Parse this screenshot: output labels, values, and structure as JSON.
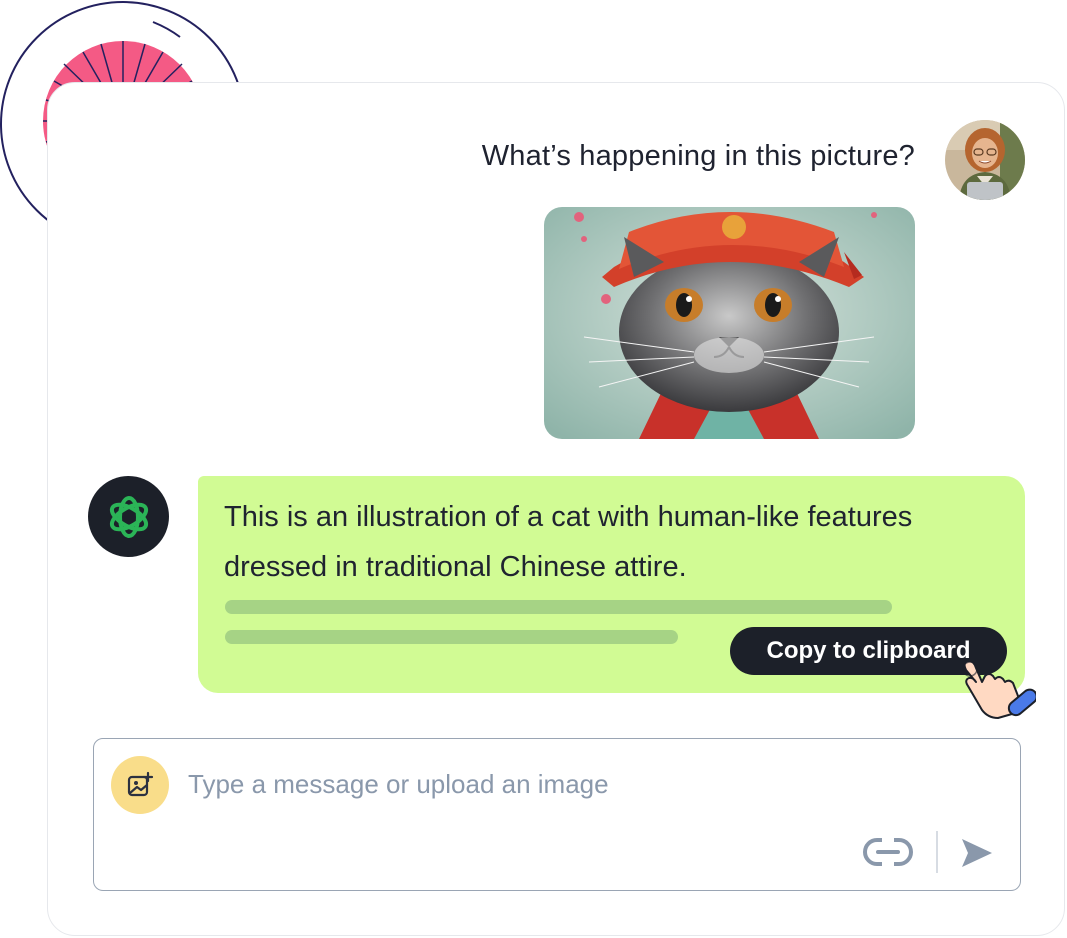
{
  "conversation": {
    "user_message": "What’s happening in this picture?",
    "assistant_message": "This is an illustration of a cat with human-like features dressed in traditional Chinese attire.",
    "copy_button_label": "Copy to clipboard"
  },
  "composer": {
    "placeholder": "Type a message or upload an image",
    "value": ""
  },
  "icons": {
    "eye": "eye-illustration",
    "user_avatar": "user-avatar",
    "assistant_avatar": "openai-logo-icon",
    "upload": "image-upload-icon",
    "link": "link-icon",
    "send": "send-icon",
    "cursor": "pointing-hand-icon"
  },
  "colors": {
    "assistant_bubble": "#d1fb94",
    "skeleton": "#a6d385",
    "dark": "#1c2029",
    "eye_iris": "#f45a85",
    "eye_pupil": "#23215f",
    "upload_bg": "#f9dd8a",
    "openai_green": "#2bb457"
  }
}
